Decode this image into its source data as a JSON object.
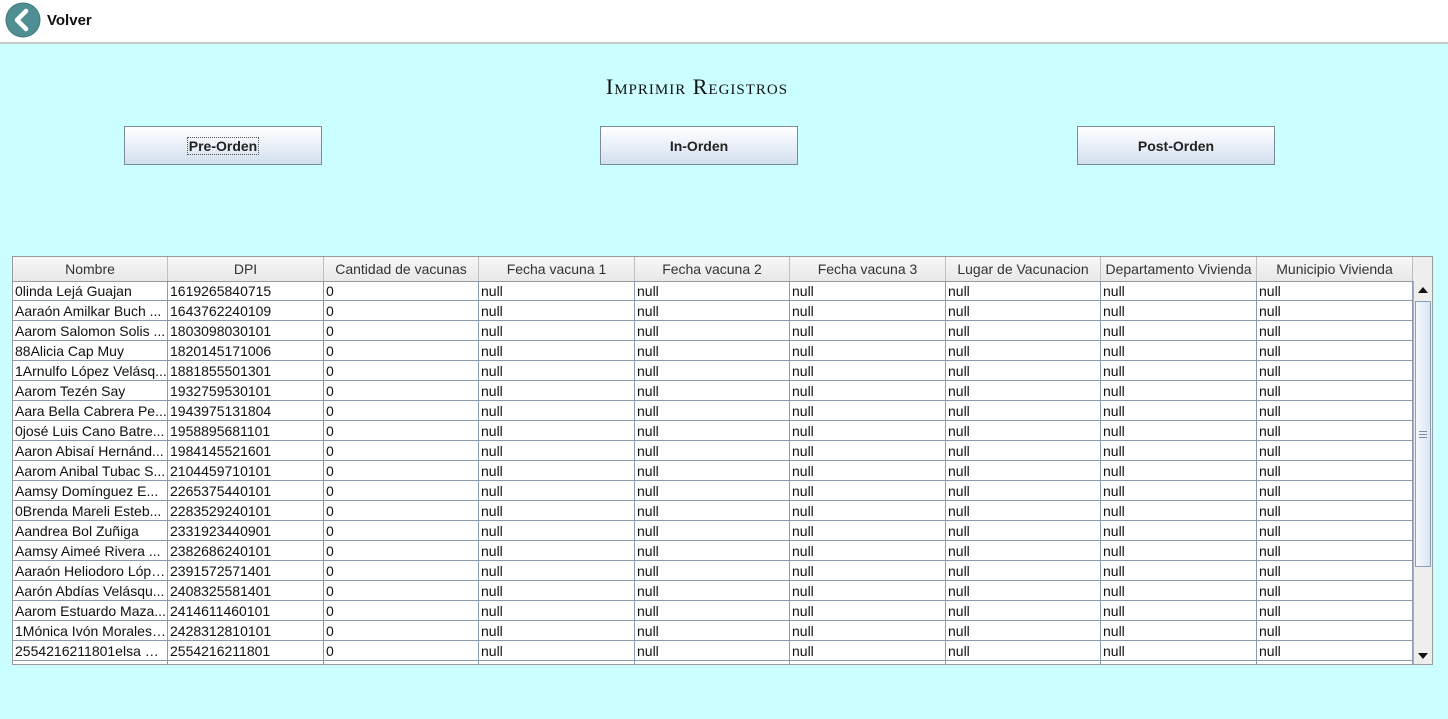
{
  "topbar": {
    "back_label": "Volver"
  },
  "page": {
    "title": "Imprimir Registros"
  },
  "buttons": {
    "pre_order": "Pre-Orden",
    "in_order": "In-Orden",
    "post_order": "Post-Orden"
  },
  "table": {
    "columns": [
      "Nombre",
      "DPI",
      "Cantidad de vacunas",
      "Fecha vacuna 1",
      "Fecha vacuna 2",
      "Fecha vacuna 3",
      "Lugar de Vacunacion",
      "Departamento Vivienda",
      "Municipio Vivienda"
    ],
    "rows": [
      [
        "0linda Lejá Guajan",
        "1619265840715",
        "0",
        "null",
        "null",
        "null",
        "null",
        "null",
        "null"
      ],
      [
        "Aaraón Amilkar Buch ...",
        "1643762240109",
        "0",
        "null",
        "null",
        "null",
        "null",
        "null",
        "null"
      ],
      [
        "Aarom Salomon Solis ...",
        "1803098030101",
        "0",
        "null",
        "null",
        "null",
        "null",
        "null",
        "null"
      ],
      [
        "88Alicia Cap Muy",
        "1820145171006",
        "0",
        "null",
        "null",
        "null",
        "null",
        "null",
        "null"
      ],
      [
        "1Arnulfo López Velásq...",
        "1881855501301",
        "0",
        "null",
        "null",
        "null",
        "null",
        "null",
        "null"
      ],
      [
        "Aarom Tezén Say",
        "1932759530101",
        "0",
        "null",
        "null",
        "null",
        "null",
        "null",
        "null"
      ],
      [
        "Aara Bella Cabrera Pe...",
        "1943975131804",
        "0",
        "null",
        "null",
        "null",
        "null",
        "null",
        "null"
      ],
      [
        "0josé Luis Cano Batre...",
        "1958895681101",
        "0",
        "null",
        "null",
        "null",
        "null",
        "null",
        "null"
      ],
      [
        "Aaron Abisaí Hernánd...",
        "1984145521601",
        "0",
        "null",
        "null",
        "null",
        "null",
        "null",
        "null"
      ],
      [
        "Aarom Anibal Tubac S...",
        "2104459710101",
        "0",
        "null",
        "null",
        "null",
        "null",
        "null",
        "null"
      ],
      [
        "Aamsy Domínguez E...",
        "2265375440101",
        "0",
        "null",
        "null",
        "null",
        "null",
        "null",
        "null"
      ],
      [
        "0Brenda Mareli Esteb...",
        "2283529240101",
        "0",
        "null",
        "null",
        "null",
        "null",
        "null",
        "null"
      ],
      [
        "Aandrea Bol Zuñiga",
        "2331923440901",
        "0",
        "null",
        "null",
        "null",
        "null",
        "null",
        "null"
      ],
      [
        "Aamsy Aimeé Rivera ...",
        "2382686240101",
        "0",
        "null",
        "null",
        "null",
        "null",
        "null",
        "null"
      ],
      [
        "Aaraón Heliodoro Lópe...",
        "2391572571401",
        "0",
        "null",
        "null",
        "null",
        "null",
        "null",
        "null"
      ],
      [
        "Aarón Abdías Velásqu...",
        "2408325581401",
        "0",
        "null",
        "null",
        "null",
        "null",
        "null",
        "null"
      ],
      [
        "Aarom Estuardo Maza...",
        "2414611460101",
        "0",
        "null",
        "null",
        "null",
        "null",
        "null",
        "null"
      ],
      [
        "1Mónica Ivón Morales ...",
        "2428312810101",
        "0",
        "null",
        "null",
        "null",
        "null",
        "null",
        "null"
      ],
      [
        "2554216211801elsa M...",
        "2554216211801",
        "0",
        "null",
        "null",
        "null",
        "null",
        "null",
        "null"
      ],
      [
        "",
        "",
        "",
        "",
        "",
        "",
        "",
        "",
        ""
      ]
    ]
  },
  "scrollbar": {
    "position": 0.0
  },
  "icons": {
    "back": "back-arrow-icon"
  },
  "colors": {
    "background": "#ccffff",
    "back_icon": "#4f8f93"
  }
}
